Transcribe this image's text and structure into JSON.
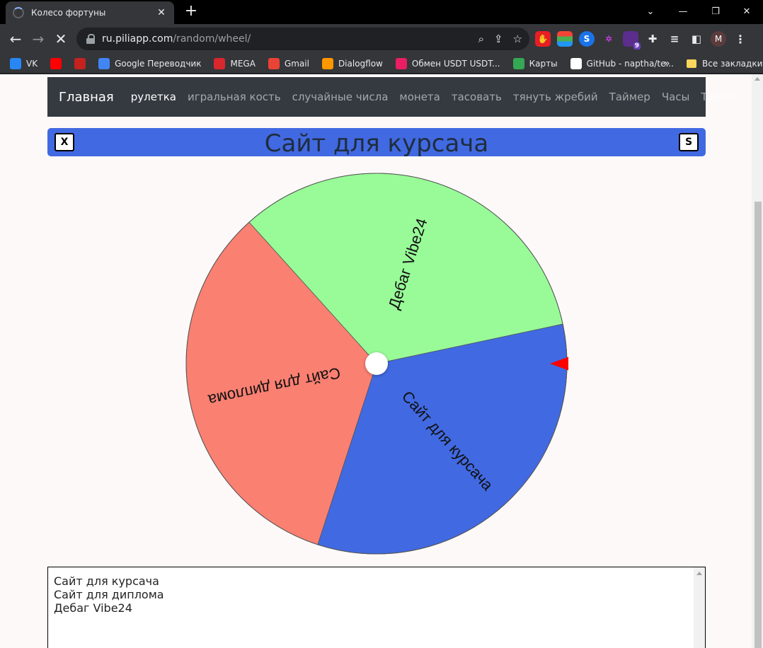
{
  "browser": {
    "tab_title": "Колесо фортуны",
    "url_host": "ru.piliapp.com",
    "url_path": "/random/wheel/",
    "profile_initial": "M",
    "extension_badge": "9",
    "bookmarks": [
      {
        "label": "VK",
        "color": "#2787f5"
      },
      {
        "label": "",
        "color": "#ff0000"
      },
      {
        "label": "",
        "color": "#c5221f"
      },
      {
        "label": "Google Переводчик",
        "color": "#4285f4"
      },
      {
        "label": "MEGA",
        "color": "#d9272e"
      },
      {
        "label": "Gmail",
        "color": "#ea4335"
      },
      {
        "label": "Dialogflow",
        "color": "#ff9800"
      },
      {
        "label": "Обмен USDT USDT...",
        "color": "#e91e63"
      },
      {
        "label": "Карты",
        "color": "#34a853"
      },
      {
        "label": "GitHub - naptha/te...",
        "color": "#ffffff"
      }
    ],
    "all_bookmarks_label": "Все закладки"
  },
  "site": {
    "brand": "Главная",
    "nav": [
      {
        "label": "рулетка",
        "active": true
      },
      {
        "label": "игральная кость",
        "active": false
      },
      {
        "label": "случайные числа",
        "active": false
      },
      {
        "label": "монета",
        "active": false
      },
      {
        "label": "тасовать",
        "active": false
      },
      {
        "label": "тянуть жребий",
        "active": false
      },
      {
        "label": "Таймер",
        "active": false
      },
      {
        "label": "Часы",
        "active": false
      },
      {
        "label": "Табло",
        "active": false
      }
    ]
  },
  "panel": {
    "title": "Сайт для курсача",
    "left_button": "X",
    "right_button": "S"
  },
  "wheel": {
    "pointer_color": "#ff0000",
    "segments": [
      {
        "label": "Сайт для курсача",
        "color": "#4169e1"
      },
      {
        "label": "Сайт для диплома",
        "color": "#fa8072"
      },
      {
        "label": "Дебаг Vibe24",
        "color": "#98fb98"
      }
    ]
  },
  "entries": {
    "lines": [
      "Сайт для курсача",
      "Сайт для диплома",
      "Дебаг Vibe24"
    ]
  }
}
